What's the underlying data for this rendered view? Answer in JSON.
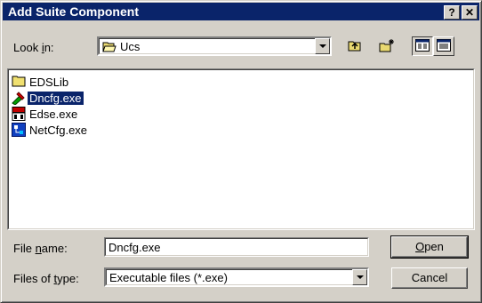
{
  "window": {
    "title": "Add Suite Component",
    "help_glyph": "?",
    "close_glyph": "✕"
  },
  "lookin": {
    "label_pre": "Look ",
    "label_underlined": "i",
    "label_post": "n:",
    "value": "Ucs"
  },
  "toolbar": {
    "icons": [
      "up-folder-icon",
      "new-folder-icon",
      "list-view-icon",
      "details-view-icon"
    ]
  },
  "files": [
    {
      "name": "EDSLib",
      "icon": "folder-icon",
      "selected": false
    },
    {
      "name": "Dncfg.exe",
      "icon": "dncfg-app-icon",
      "selected": true
    },
    {
      "name": "Edse.exe",
      "icon": "eds-app-icon",
      "selected": false
    },
    {
      "name": "NetCfg.exe",
      "icon": "netcfg-app-icon",
      "selected": false
    }
  ],
  "filename": {
    "label_pre": "File ",
    "label_underlined": "n",
    "label_post": "ame:",
    "value": "Dncfg.exe"
  },
  "filetype": {
    "label_pre": "Files of ",
    "label_underlined": "t",
    "label_post": "ype:",
    "value": "Executable files (*.exe)"
  },
  "buttons": {
    "open_underlined": "O",
    "open_rest": "pen",
    "cancel": "Cancel"
  }
}
